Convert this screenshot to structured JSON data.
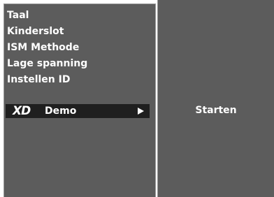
{
  "menu": {
    "items": [
      {
        "label": "Taal"
      },
      {
        "label": "Kinderslot"
      },
      {
        "label": "ISM Methode"
      },
      {
        "label": "Lage spanning"
      },
      {
        "label": "Instellen ID"
      }
    ],
    "selected": {
      "logo": "XD",
      "label": "Demo",
      "icon": "arrow-right-icon"
    }
  },
  "submenu": {
    "action": "Starten"
  },
  "colors": {
    "panel": "#5c5c5c",
    "highlight": "#1f1f1f",
    "text": "#ffffff",
    "border": "#9a9a9a"
  }
}
